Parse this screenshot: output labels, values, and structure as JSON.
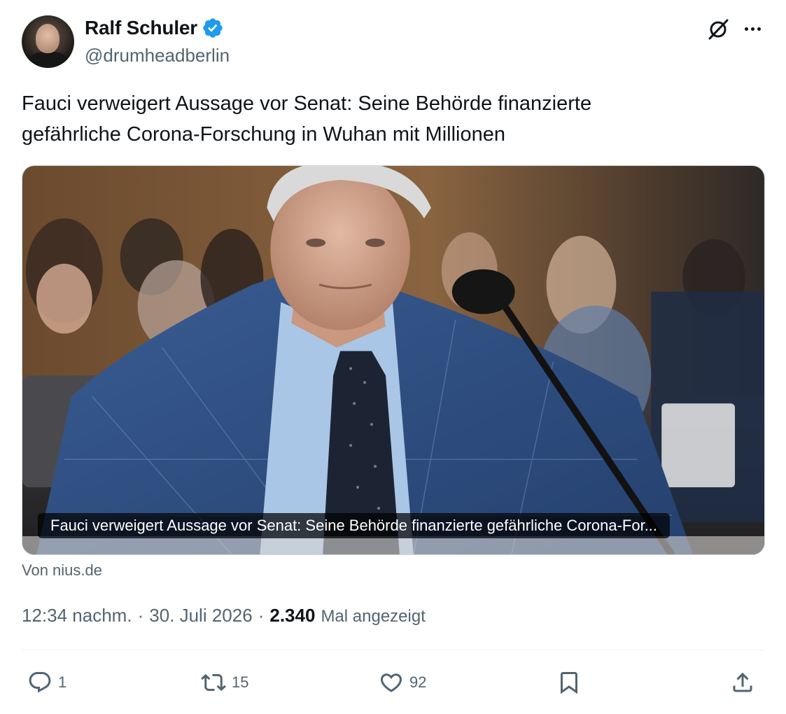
{
  "author": {
    "display_name": "Ralf Schuler",
    "handle": "@drumheadberlin",
    "verified": true
  },
  "tweet": {
    "text_line1": "Fauci verweigert Aussage vor Senat: Seine Behörde finanzierte",
    "text_line2": "gefährliche Corona-Forschung in Wuhan mit Millionen"
  },
  "card": {
    "caption": "Fauci verweigert Aussage vor Senat: Seine Behörde finanzierte gefährliche Corona-For...",
    "source": "Von nius.de"
  },
  "meta": {
    "time": "12:34 nachm.",
    "separator": "·",
    "date": "30. Juli 2026",
    "views": "2.340",
    "views_label": "Mal angezeigt"
  },
  "actions": {
    "replies": "1",
    "reposts": "15",
    "likes": "92"
  },
  "colors": {
    "verified": "#1d9bf0",
    "text_primary": "#0f1419",
    "text_secondary": "#536471"
  },
  "icons": [
    "verified-badge-icon",
    "grok-icon",
    "more-icon",
    "reply-icon",
    "repost-icon",
    "like-icon",
    "bookmark-icon",
    "share-icon"
  ]
}
